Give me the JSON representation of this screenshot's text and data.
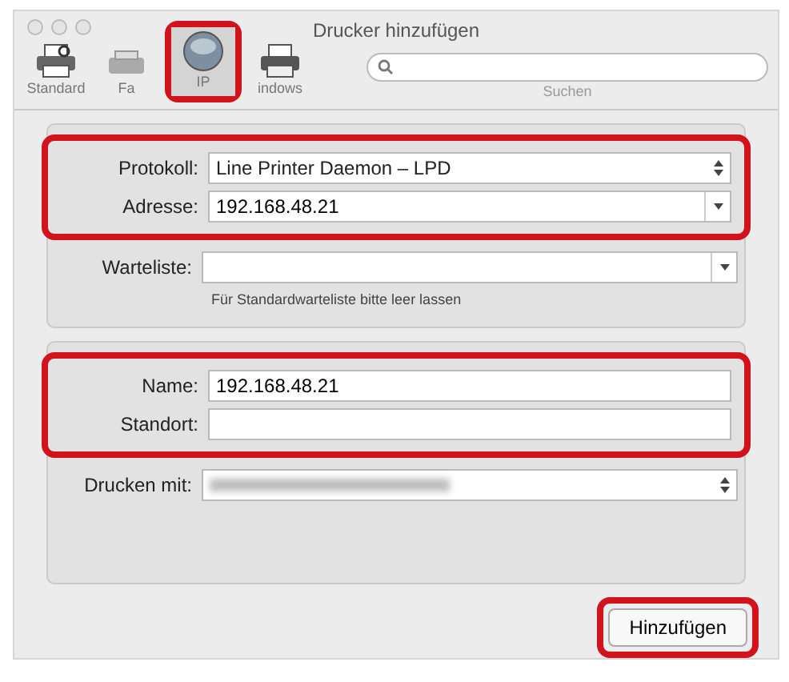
{
  "window": {
    "title": "Drucker hinzufügen"
  },
  "toolbar": [
    {
      "label": "Standard",
      "kind": "printer",
      "selected": false,
      "highlighted": false
    },
    {
      "label": "Fa",
      "kind": "fax",
      "selected": false,
      "highlighted": false
    },
    {
      "label": "IP",
      "kind": "globe",
      "selected": true,
      "highlighted": true
    },
    {
      "label": "indows",
      "kind": "windows",
      "selected": false,
      "highlighted": false
    }
  ],
  "search": {
    "label": "Suchen"
  },
  "panels": [
    {
      "groups": [
        {
          "highlighted": true,
          "fields": [
            {
              "label": "Protokoll:",
              "kind": "select",
              "value": "Line Printer Daemon – LPD"
            },
            {
              "label": "Adresse:",
              "kind": "combo",
              "value": "192.168.48.21"
            }
          ]
        },
        {
          "highlighted": false,
          "fields": [
            {
              "label": "Warteliste:",
              "kind": "combo",
              "hint": "Für Standardwarteliste bitte leer lassen"
            }
          ]
        }
      ]
    },
    {
      "groups": [
        {
          "highlighted": true,
          "fields": [
            {
              "label": "Name:",
              "kind": "text",
              "value": "192.168.48.21"
            },
            {
              "label": "Standort:",
              "kind": "text"
            }
          ]
        },
        {
          "highlighted": false,
          "fields": [
            {
              "label": "Drucken mit:",
              "kind": "select",
              "blurred": true
            }
          ]
        }
      ]
    }
  ],
  "buttons": [
    {
      "label": "Hinzufügen",
      "highlighted": true
    }
  ]
}
